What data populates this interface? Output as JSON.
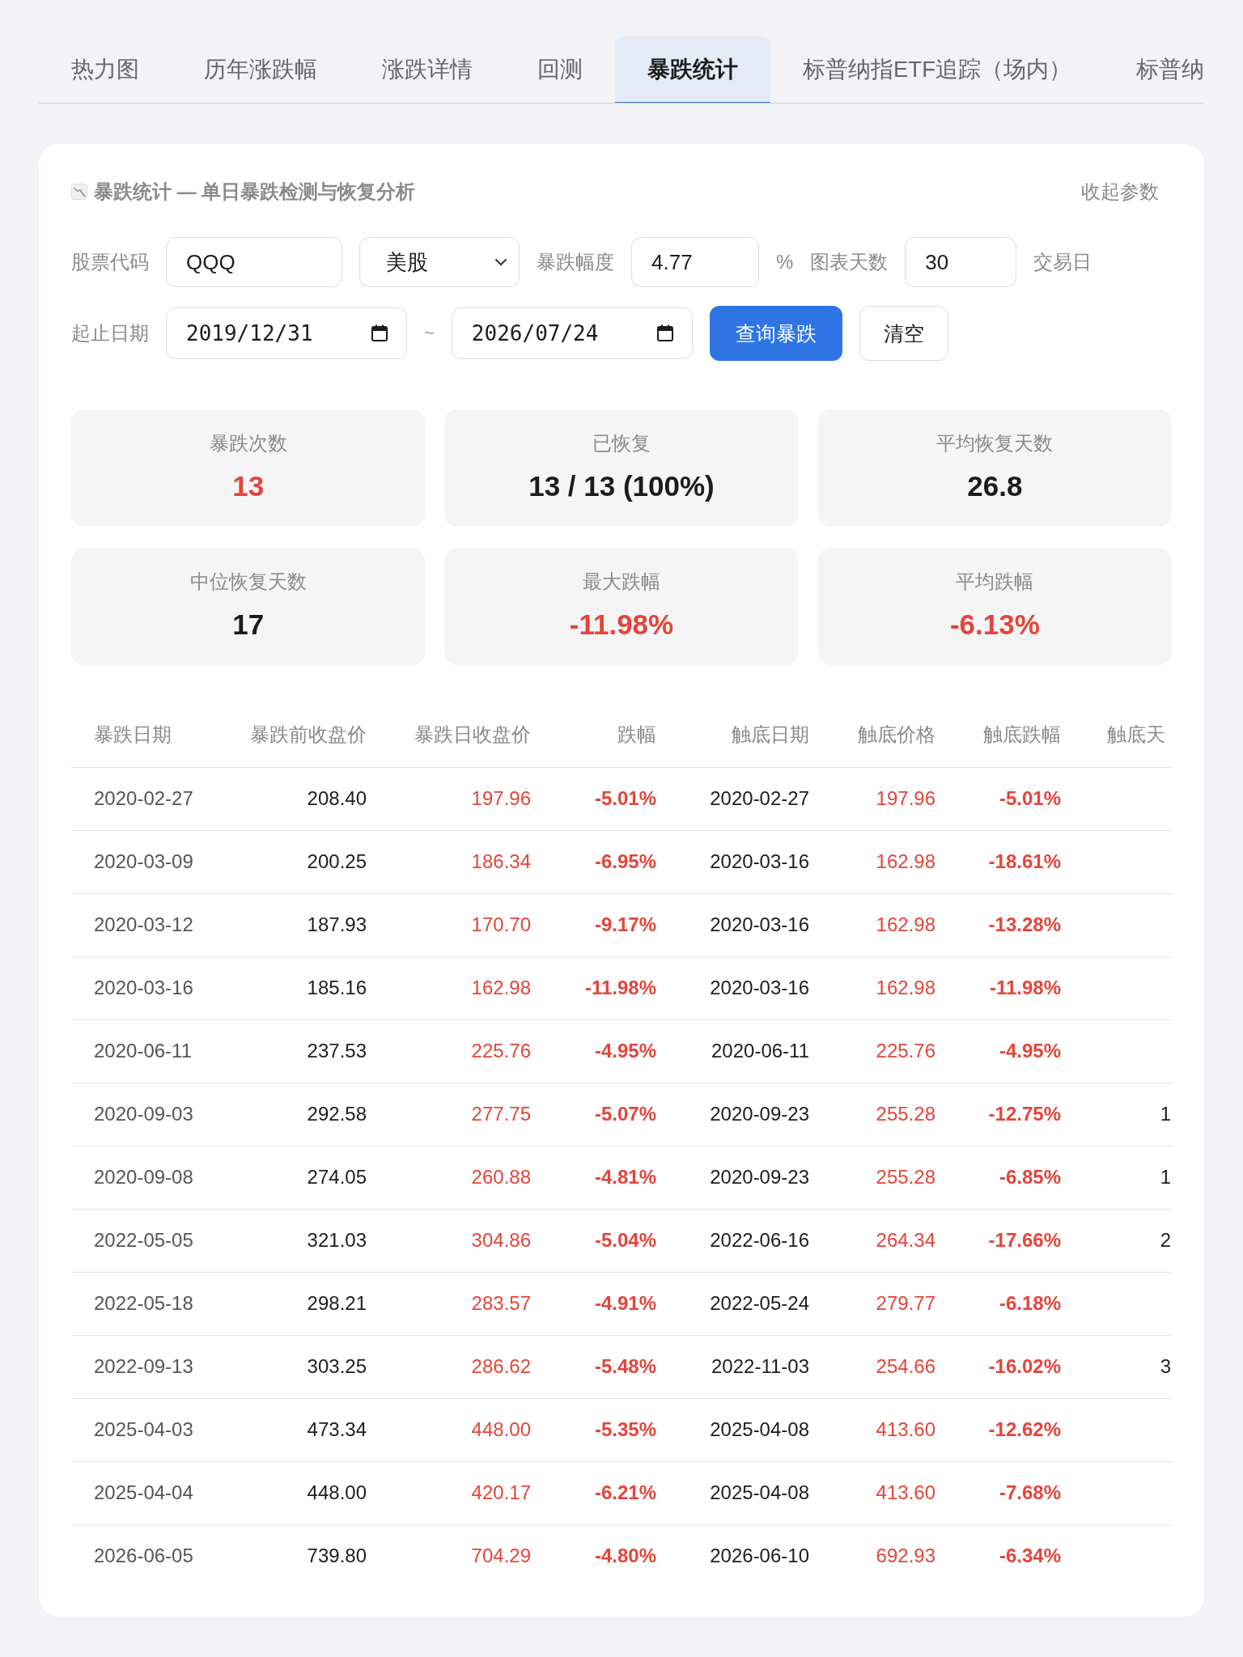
{
  "tabs": [
    {
      "label": "热力图",
      "selected": false
    },
    {
      "label": "历年涨跌幅",
      "selected": false
    },
    {
      "label": "涨跌详情",
      "selected": false
    },
    {
      "label": "回测",
      "selected": false
    },
    {
      "label": "暴跌统计",
      "selected": true
    },
    {
      "label": "标普纳指ETF追踪（场内）",
      "selected": false
    },
    {
      "label": "标普纳",
      "selected": false
    }
  ],
  "panel": {
    "title": "暴跌统计 — 单日暴跌检测与恢复分析",
    "collapse_link": "收起参数"
  },
  "form": {
    "stock_code": {
      "label": "股票代码",
      "value": "QQQ"
    },
    "market": {
      "value": "美股"
    },
    "drop_threshold": {
      "label": "暴跌幅度",
      "value": "4.77",
      "unit": "%"
    },
    "chart_days": {
      "label": "图表天数",
      "value": "30",
      "unit": "交易日"
    },
    "date_range": {
      "label": "起止日期",
      "start": "2019/12/31",
      "separator": "~",
      "end": "2026/07/24"
    },
    "buttons": [
      {
        "label": "查询暴跌",
        "kind": "primary"
      },
      {
        "label": "清空",
        "kind": "secondary"
      }
    ]
  },
  "stats": [
    {
      "label": "暴跌次数",
      "value": "13",
      "highlight": true
    },
    {
      "label": "已恢复",
      "value": "13 / 13 (100%)",
      "highlight": false
    },
    {
      "label": "平均恢复天数",
      "value": "26.8",
      "highlight": false
    },
    {
      "label": "中位恢复天数",
      "value": "17",
      "highlight": false
    },
    {
      "label": "最大跌幅",
      "value": "-11.98%",
      "highlight": true
    },
    {
      "label": "平均跌幅",
      "value": "-6.13%",
      "highlight": true
    }
  ],
  "table": {
    "columns": [
      "暴跌日期",
      "暴跌前收盘价",
      "暴跌日收盘价",
      "跌幅",
      "触底日期",
      "触底价格",
      "触底跌幅",
      "触底天"
    ],
    "rows": [
      [
        "2020-02-27",
        "208.40",
        "197.96",
        "-5.01%",
        "2020-02-27",
        "197.96",
        "-5.01%"
      ],
      [
        "2020-03-09",
        "200.25",
        "186.34",
        "-6.95%",
        "2020-03-16",
        "162.98",
        "-18.61%"
      ],
      [
        "2020-03-12",
        "187.93",
        "170.70",
        "-9.17%",
        "2020-03-16",
        "162.98",
        "-13.28%"
      ],
      [
        "2020-03-16",
        "185.16",
        "162.98",
        "-11.98%",
        "2020-03-16",
        "162.98",
        "-11.98%"
      ],
      [
        "2020-06-11",
        "237.53",
        "225.76",
        "-4.95%",
        "2020-06-11",
        "225.76",
        "-4.95%"
      ],
      [
        "2020-09-03",
        "292.58",
        "277.75",
        "-5.07%",
        "2020-09-23",
        "255.28",
        "-12.75%",
        "1"
      ],
      [
        "2020-09-08",
        "274.05",
        "260.88",
        "-4.81%",
        "2020-09-23",
        "255.28",
        "-6.85%",
        "1"
      ],
      [
        "2022-05-05",
        "321.03",
        "304.86",
        "-5.04%",
        "2022-06-16",
        "264.34",
        "-17.66%",
        "2"
      ],
      [
        "2022-05-18",
        "298.21",
        "283.57",
        "-4.91%",
        "2022-05-24",
        "279.77",
        "-6.18%"
      ],
      [
        "2022-09-13",
        "303.25",
        "286.62",
        "-5.48%",
        "2022-11-03",
        "254.66",
        "-16.02%",
        "3"
      ],
      [
        "2025-04-03",
        "473.34",
        "448.00",
        "-5.35%",
        "2025-04-08",
        "413.60",
        "-12.62%"
      ],
      [
        "2025-04-04",
        "448.00",
        "420.17",
        "-6.21%",
        "2025-04-08",
        "413.60",
        "-7.68%"
      ],
      [
        "2026-06-05",
        "739.80",
        "704.29",
        "-4.80%",
        "2026-06-10",
        "692.93",
        "-6.34%"
      ]
    ]
  }
}
